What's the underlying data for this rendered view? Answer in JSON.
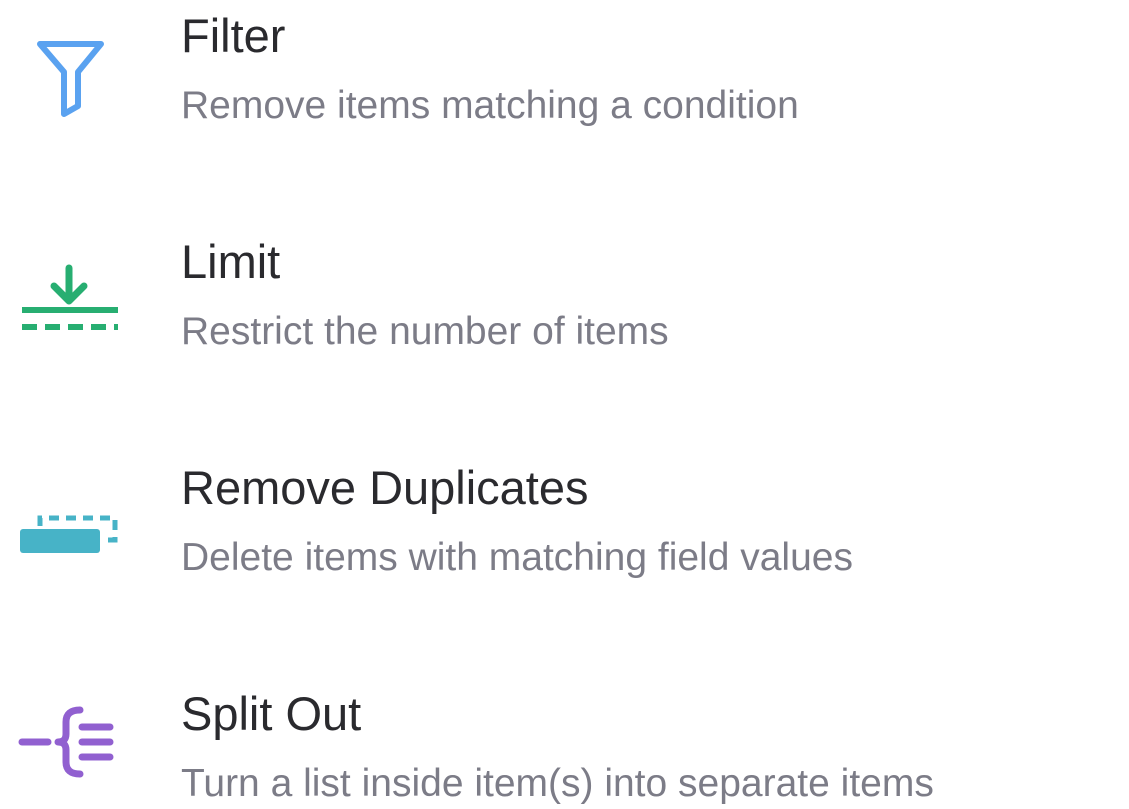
{
  "items": [
    {
      "icon": "filter-icon",
      "icon_color": "#5aa2f0",
      "title": "Filter",
      "description": "Remove items matching a condition"
    },
    {
      "icon": "limit-icon",
      "icon_color": "#27ae71",
      "title": "Limit",
      "description": "Restrict the number of items"
    },
    {
      "icon": "remove-duplicates-icon",
      "icon_color": "#47b3c7",
      "title": "Remove Duplicates",
      "description": "Delete items with matching field values"
    },
    {
      "icon": "split-out-icon",
      "icon_color": "#9160d0",
      "title": "Split Out",
      "description": "Turn a list inside item(s) into separate items"
    }
  ],
  "colors": {
    "title": "#2a2a2e",
    "description": "#7c7c87"
  }
}
